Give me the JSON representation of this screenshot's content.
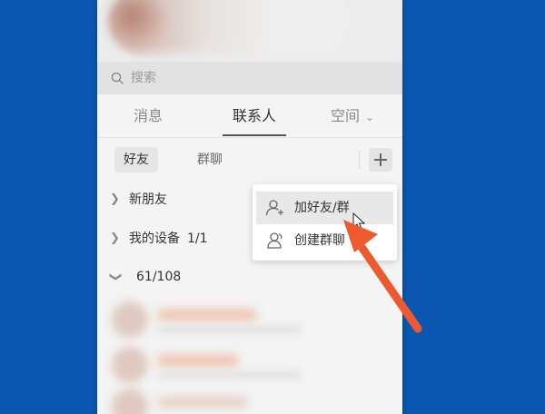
{
  "search": {
    "placeholder": "搜索",
    "icon": "search-icon"
  },
  "tabs": [
    {
      "label": "消息",
      "active": false
    },
    {
      "label": "联系人",
      "active": true
    },
    {
      "label": "空间",
      "active": false,
      "has_dropdown": true
    }
  ],
  "subtabs": [
    {
      "label": "好友",
      "active": true
    },
    {
      "label": "群聊",
      "active": false
    }
  ],
  "add_button": {
    "icon": "plus-icon"
  },
  "groups": [
    {
      "label": "新朋友",
      "count": "",
      "expanded": false
    },
    {
      "label": "我的设备",
      "count": "1/1",
      "expanded": false
    },
    {
      "label": "",
      "count": "61/108",
      "expanded": true
    }
  ],
  "menu": {
    "items": [
      {
        "label": "加好友/群",
        "icon": "add-user-icon",
        "highlighted": true
      },
      {
        "label": "创建群聊",
        "icon": "users-icon",
        "highlighted": false
      }
    ]
  },
  "colors": {
    "background": "#0b56b0",
    "panel": "#f4f4f4",
    "annotation_arrow": "#ee5a2f"
  }
}
